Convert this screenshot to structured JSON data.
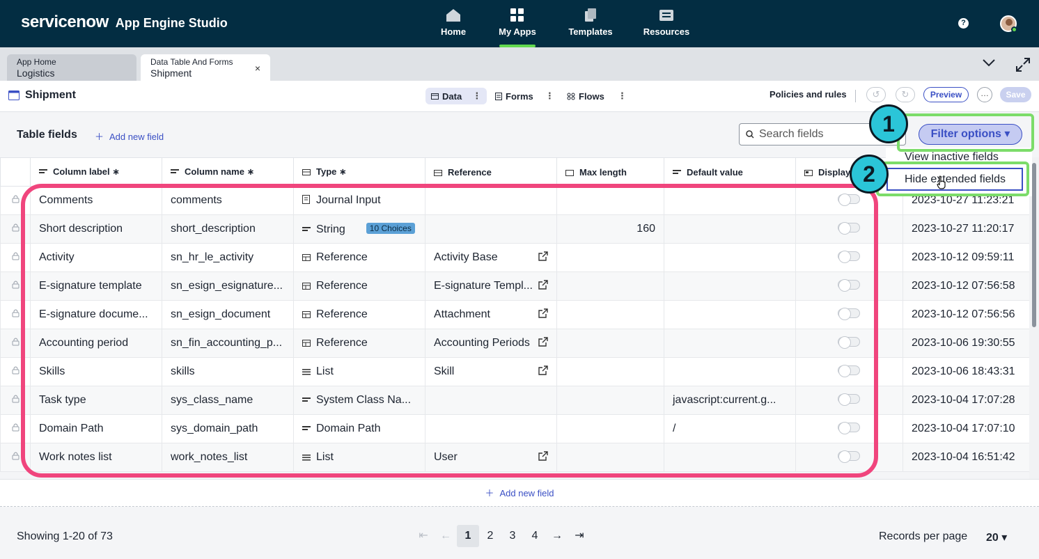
{
  "topnav": {
    "brand": "servicenow",
    "app_name": "App Engine Studio",
    "items": [
      {
        "label": "Home",
        "icon": "home-icon"
      },
      {
        "label": "My Apps",
        "icon": "grid-icon",
        "active": true
      },
      {
        "label": "Templates",
        "icon": "templates-icon"
      },
      {
        "label": "Resources",
        "icon": "resources-icon"
      }
    ],
    "help": "?"
  },
  "tabs": [
    {
      "line1": "App Home",
      "line2": "Logistics"
    },
    {
      "line1": "Data Table And Forms",
      "line2": "Shipment",
      "close": "×"
    }
  ],
  "page": {
    "title": "Shipment",
    "segments": [
      "Data",
      "Forms",
      "Flows"
    ],
    "policies": "Policies and rules",
    "preview": "Preview",
    "more": "…",
    "save": "Save"
  },
  "table_header": {
    "title": "Table fields",
    "add_field": "Add new field",
    "search_placeholder": "Search fields",
    "filter_button": "Filter options ▾",
    "menu_view_inactive": "View inactive fields",
    "menu_hide_extended": "Hide extended fields"
  },
  "annotations": {
    "badge1": "1",
    "badge2": "2"
  },
  "columns": [
    "Column label ∗",
    "Column name ∗",
    "Type ∗",
    "Reference",
    "Max length",
    "Default value",
    "Display",
    ""
  ],
  "rows": [
    {
      "label": "Comments",
      "name": "comments",
      "type": "Journal Input",
      "type_icon": "journal-icon",
      "reference": "",
      "max": "",
      "default": "",
      "updated": "2023-10-27 11:23:21"
    },
    {
      "label": "Short description",
      "name": "short_description",
      "type": "String",
      "type_icon": "string-icon",
      "choices": "10 Choices",
      "reference": "",
      "max": "160",
      "default": "",
      "updated": "2023-10-27 11:20:17"
    },
    {
      "label": "Activity",
      "name": "sn_hr_le_activity",
      "type": "Reference",
      "type_icon": "reference-icon",
      "reference": "Activity Base",
      "max": "",
      "default": "",
      "updated": "2023-10-12 09:59:11"
    },
    {
      "label": "E-signature template",
      "name": "sn_esign_esignature...",
      "type": "Reference",
      "type_icon": "reference-icon",
      "reference": "E-signature Templ...",
      "max": "",
      "default": "",
      "updated": "2023-10-12 07:56:58"
    },
    {
      "label": "E-signature docume...",
      "name": "sn_esign_document",
      "type": "Reference",
      "type_icon": "reference-icon",
      "reference": "Attachment",
      "max": "",
      "default": "",
      "updated": "2023-10-12 07:56:56"
    },
    {
      "label": "Accounting period",
      "name": "sn_fin_accounting_p...",
      "type": "Reference",
      "type_icon": "reference-icon",
      "reference": "Accounting Periods",
      "max": "",
      "default": "",
      "updated": "2023-10-06 19:30:55"
    },
    {
      "label": "Skills",
      "name": "skills",
      "type": "List",
      "type_icon": "list-icon",
      "reference": "Skill",
      "max": "",
      "default": "",
      "updated": "2023-10-06 18:43:31"
    },
    {
      "label": "Task type",
      "name": "sys_class_name",
      "type": "System Class Na...",
      "type_icon": "string-icon",
      "reference": "",
      "max": "",
      "default": "javascript:current.g...",
      "updated": "2023-10-04 17:07:28"
    },
    {
      "label": "Domain Path",
      "name": "sys_domain_path",
      "type": "Domain Path",
      "type_icon": "string-icon",
      "reference": "",
      "max": "",
      "default": "/",
      "updated": "2023-10-04 17:07:10"
    },
    {
      "label": "Work notes list",
      "name": "work_notes_list",
      "type": "List",
      "type_icon": "list-icon",
      "reference": "User",
      "max": "",
      "default": "",
      "updated": "2023-10-04 16:51:42"
    }
  ],
  "add_row": "Add new field",
  "footer": {
    "showing": "Showing 1-20 of 73",
    "pages": [
      "1",
      "2",
      "3",
      "4"
    ],
    "current_page": "1",
    "records_label": "Records per page",
    "records_value": "20 ▾"
  },
  "colors": {
    "nav_bg": "#032d42",
    "accent": "#3a4fc4",
    "active_green": "#62d84e",
    "highlight_green": "#7cdc6a",
    "highlight_pink": "#f0457d",
    "badge": "#2bc5d8"
  }
}
